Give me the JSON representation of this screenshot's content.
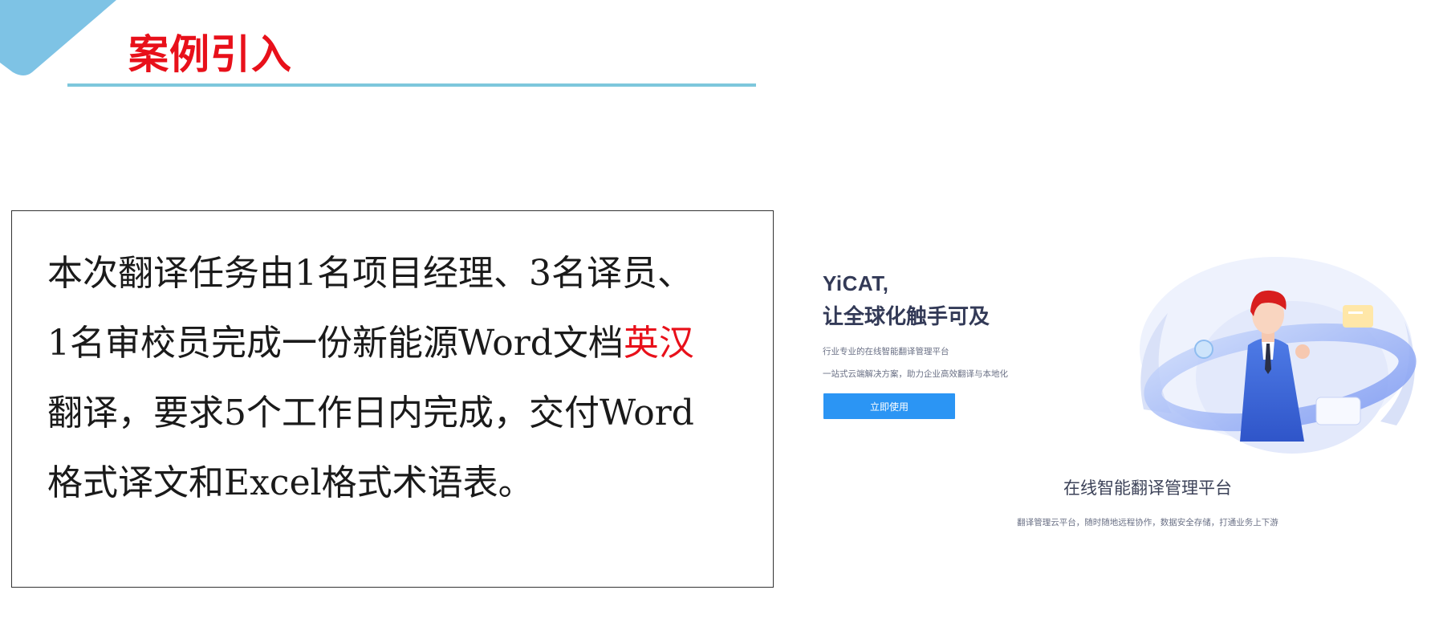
{
  "slide": {
    "title": "案例引入"
  },
  "case_box": {
    "lines": [
      {
        "pre": "本次翻译任务由1名项目经理、3名译员、",
        "hl": "",
        "post": ""
      },
      {
        "pre": "1名审校员完成一份新能源Word文档",
        "hl": "英汉",
        "post": ""
      },
      {
        "pre": "翻译，要求5个工作日内完成，交付Word",
        "hl": "",
        "post": ""
      },
      {
        "pre": "格式译文和Excel格式术语表。",
        "hl": "",
        "post": ""
      }
    ]
  },
  "yicat": {
    "brand": "YiCAT,",
    "tagline": "让全球化触手可及",
    "sub1": "行业专业的在线智能翻译管理平台",
    "sub2": "一站式云端解决方案，助力企业高效翻译与本地化",
    "cta_label": "立即使用",
    "platform_title": "在线智能翻译管理平台",
    "platform_sub": "翻译管理云平台，随时随地远程协作，数据安全存储，打通业务上下游"
  },
  "colors": {
    "accent_red": "#e8101a",
    "rule_blue": "#7dc7dc",
    "cta_blue": "#2b95f4"
  }
}
